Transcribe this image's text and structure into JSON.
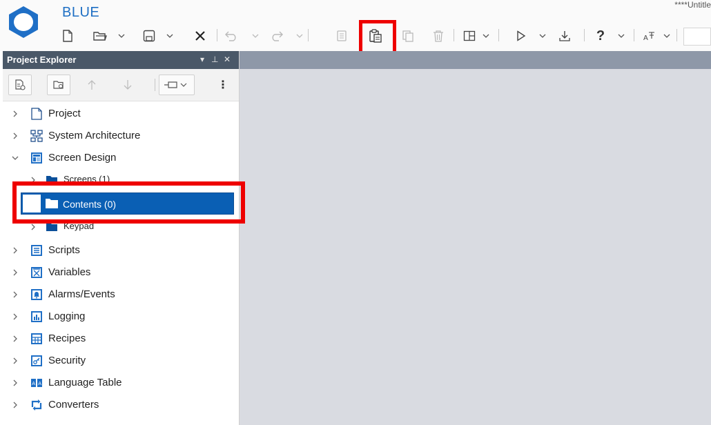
{
  "app": {
    "name": "BLUE",
    "document_title": "****Untitle"
  },
  "colors": {
    "accent": "#1e6fc4",
    "panel_header": "#4a5868",
    "selection": "#0a5fb4",
    "highlight_box": "#ee0000",
    "workspace": "#d9dbe1"
  },
  "toolbar": {
    "items": [
      {
        "name": "new-icon",
        "label": "New"
      },
      {
        "name": "open-icon",
        "label": "Open"
      },
      {
        "name": "save-icon",
        "label": "Save"
      },
      {
        "name": "close-icon",
        "label": "Close"
      },
      {
        "name": "undo-icon",
        "label": "Undo"
      },
      {
        "name": "redo-icon",
        "label": "Redo"
      },
      {
        "name": "copy-icon",
        "label": "Copy"
      },
      {
        "name": "paste-icon",
        "label": "Paste"
      },
      {
        "name": "duplicate-icon",
        "label": "Duplicate"
      },
      {
        "name": "delete-icon",
        "label": "Delete"
      },
      {
        "name": "layout-icon",
        "label": "Layout"
      },
      {
        "name": "run-icon",
        "label": "Run"
      },
      {
        "name": "download-icon",
        "label": "Download"
      },
      {
        "name": "help-icon",
        "label": "?"
      },
      {
        "name": "text-format-icon",
        "label": "Text"
      }
    ],
    "help_glyph": "?"
  },
  "explorer": {
    "title": "Project Explorer",
    "pin_glyph": "▾",
    "dock_glyph": "⊥",
    "close_glyph": "✕",
    "menu_glyph": "⋮",
    "tree": [
      {
        "label": "Project",
        "icon": "document-icon",
        "expanded": false
      },
      {
        "label": "System Architecture",
        "icon": "architecture-icon",
        "expanded": false
      },
      {
        "label": "Screen Design",
        "icon": "screen-design-icon",
        "expanded": true
      },
      {
        "label": "Screens (1)",
        "icon": "folder-icon",
        "expanded": false,
        "child": true
      },
      {
        "label": "Contents (0)",
        "icon": "folder-icon",
        "selected": true,
        "child": true
      },
      {
        "label": "Keypad",
        "icon": "folder-icon",
        "expanded": false,
        "child": true
      },
      {
        "label": "Scripts",
        "icon": "scripts-icon",
        "expanded": false
      },
      {
        "label": "Variables",
        "icon": "variables-icon",
        "expanded": false
      },
      {
        "label": "Alarms/Events",
        "icon": "alarm-icon",
        "expanded": false
      },
      {
        "label": "Logging",
        "icon": "logging-icon",
        "expanded": false
      },
      {
        "label": "Recipes",
        "icon": "recipes-icon",
        "expanded": false
      },
      {
        "label": "Security",
        "icon": "security-icon",
        "expanded": false
      },
      {
        "label": "Language Table",
        "icon": "language-table-icon",
        "expanded": false
      },
      {
        "label": "Converters",
        "icon": "converters-icon",
        "expanded": false
      }
    ]
  }
}
